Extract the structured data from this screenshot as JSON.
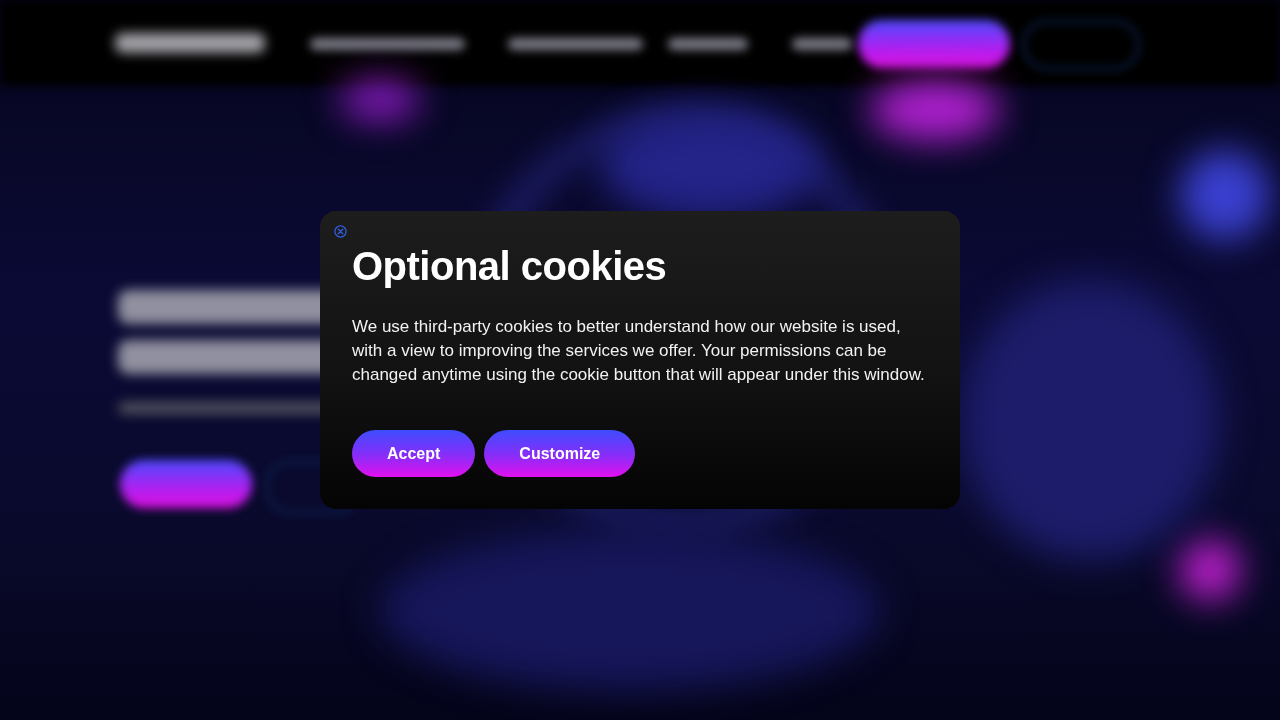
{
  "dialog": {
    "title": "Optional cookies",
    "text": "We use third-party cookies to better understand how our website is used, with a view to improving the services we offer. Your permissions can be changed anytime using the cookie button that will appear under this window.",
    "buttons": [
      "Accept",
      "Customize"
    ]
  }
}
